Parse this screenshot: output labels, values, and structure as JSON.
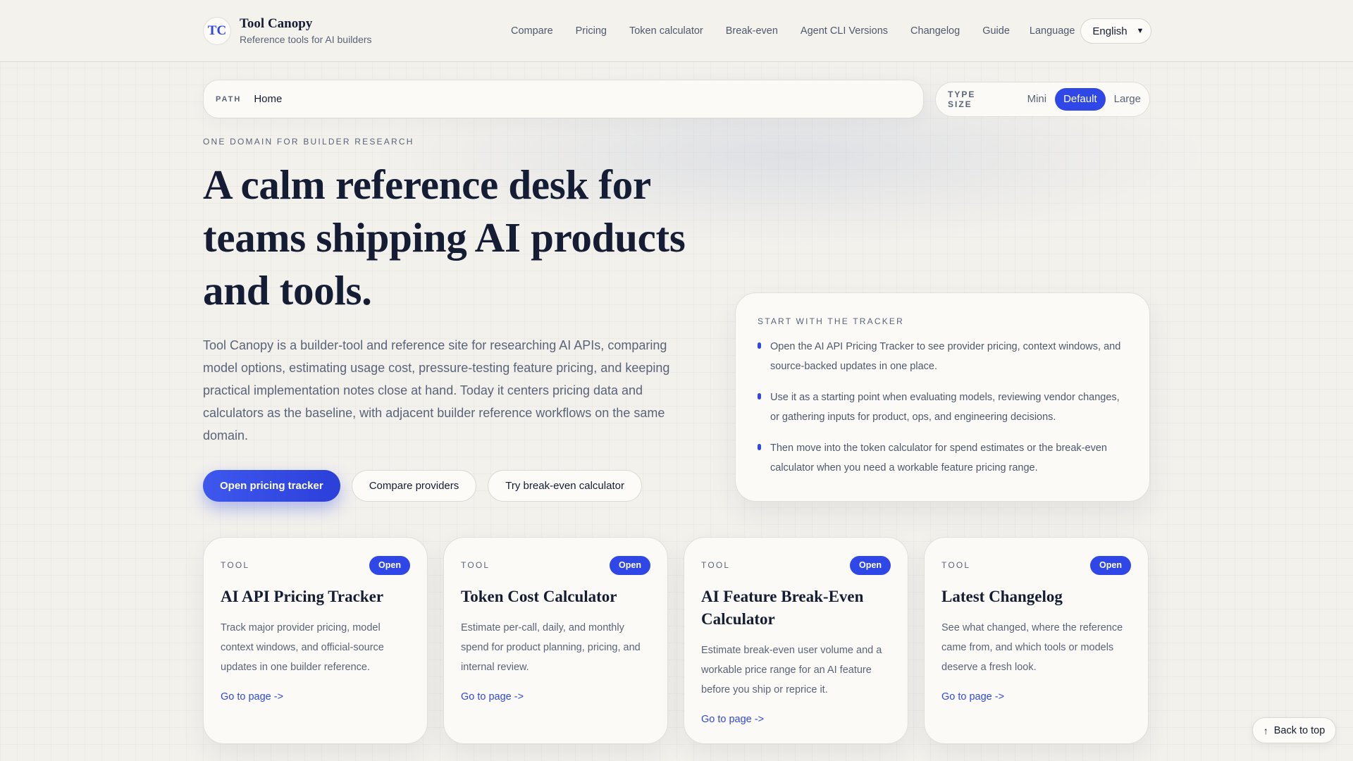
{
  "brand": {
    "logo_text": "TC",
    "name": "Tool Canopy",
    "tagline": "Reference tools for AI builders"
  },
  "nav": {
    "items": [
      "Compare",
      "Pricing",
      "Token calculator",
      "Break-even",
      "Agent CLI Versions",
      "Changelog",
      "Guide"
    ],
    "language_label": "Language",
    "language_selected": "English"
  },
  "pathbar": {
    "label": "PATH",
    "current": "Home"
  },
  "type_size": {
    "label": "TYPE SIZE",
    "options": [
      "Mini",
      "Default",
      "Large"
    ],
    "selected": "Default"
  },
  "hero": {
    "eyebrow": "ONE DOMAIN FOR BUILDER RESEARCH",
    "title": "A calm reference desk for teams shipping AI products and tools.",
    "description": "Tool Canopy is a builder-tool and reference site for researching AI APIs, comparing model options, estimating usage cost, pressure-testing feature pricing, and keeping practical implementation notes close at hand. Today it centers pricing data and calculators as the baseline, with adjacent builder reference workflows on the same domain.",
    "buttons": {
      "primary": "Open pricing tracker",
      "compare": "Compare providers",
      "breakeven": "Try break-even calculator"
    }
  },
  "tracker": {
    "eyebrow": "START WITH THE TRACKER",
    "items": [
      "Open the AI API Pricing Tracker to see provider pricing, context windows, and source-backed updates in one place.",
      "Use it as a starting point when evaluating models, reviewing vendor changes, or gathering inputs for product, ops, and engineering decisions.",
      "Then move into the token calculator for spend estimates or the break-even calculator when you need a workable feature pricing range."
    ]
  },
  "cards": [
    {
      "tag": "TOOL",
      "badge": "Open",
      "title": "AI API Pricing Tracker",
      "description": "Track major provider pricing, model context windows, and official-source updates in one builder reference.",
      "link": "Go to page ->"
    },
    {
      "tag": "TOOL",
      "badge": "Open",
      "title": "Token Cost Calculator",
      "description": "Estimate per-call, daily, and monthly spend for product planning, pricing, and internal review.",
      "link": "Go to page ->"
    },
    {
      "tag": "TOOL",
      "badge": "Open",
      "title": "AI Feature Break-Even Calculator",
      "description": "Estimate break-even user volume and a workable price range for an AI feature before you ship or reprice it.",
      "link": "Go to page ->"
    },
    {
      "tag": "TOOL",
      "badge": "Open",
      "title": "Latest Changelog",
      "description": "See what changed, where the reference came from, and which tools or models deserve a fresh look.",
      "link": "Go to page ->"
    }
  ],
  "back_to_top": {
    "icon": "arrow-up-icon",
    "label": "Back to top"
  },
  "colors": {
    "accent": "#2f47e6",
    "heading": "#141d33",
    "body_text": "#5a6378",
    "background": "#f3f1ec",
    "card": "#fbfaf7"
  }
}
